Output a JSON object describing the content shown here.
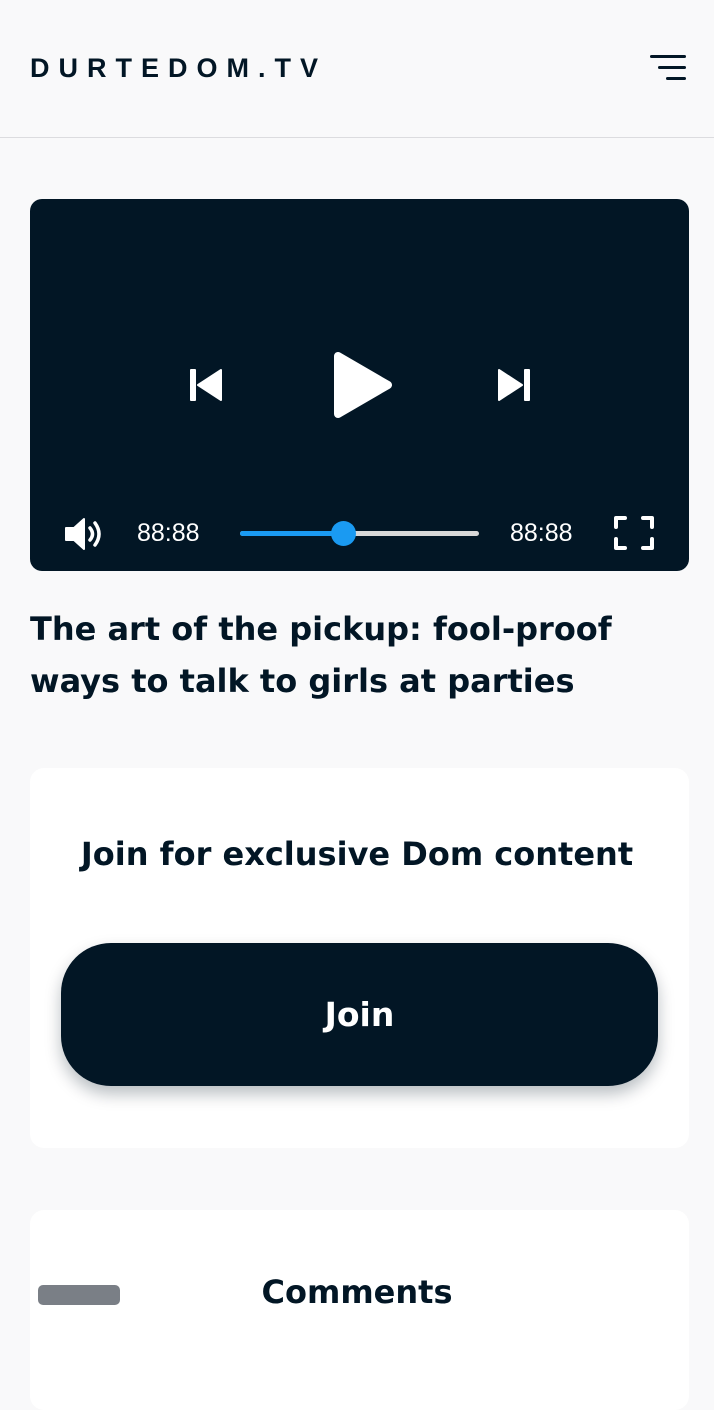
{
  "header": {
    "logo": "DURTEDOM.TV",
    "menu_icon": "menu-icon"
  },
  "player": {
    "icons": {
      "previous": "skip-previous-icon",
      "play": "play-icon",
      "next": "skip-next-icon",
      "volume": "volume-icon",
      "fullscreen": "fullscreen-icon"
    },
    "current_time": "88:88",
    "duration": "88:88",
    "progress_fraction": 0.43,
    "colors": {
      "background": "#021625",
      "progress": "#1a9af2",
      "track": "#d8d8d8"
    }
  },
  "video": {
    "title": "The art of the pickup: fool-proof ways to talk to girls at parties"
  },
  "join": {
    "heading": "Join for exclusive Dom content",
    "button_label": "Join"
  },
  "comments": {
    "heading": "Comments"
  }
}
